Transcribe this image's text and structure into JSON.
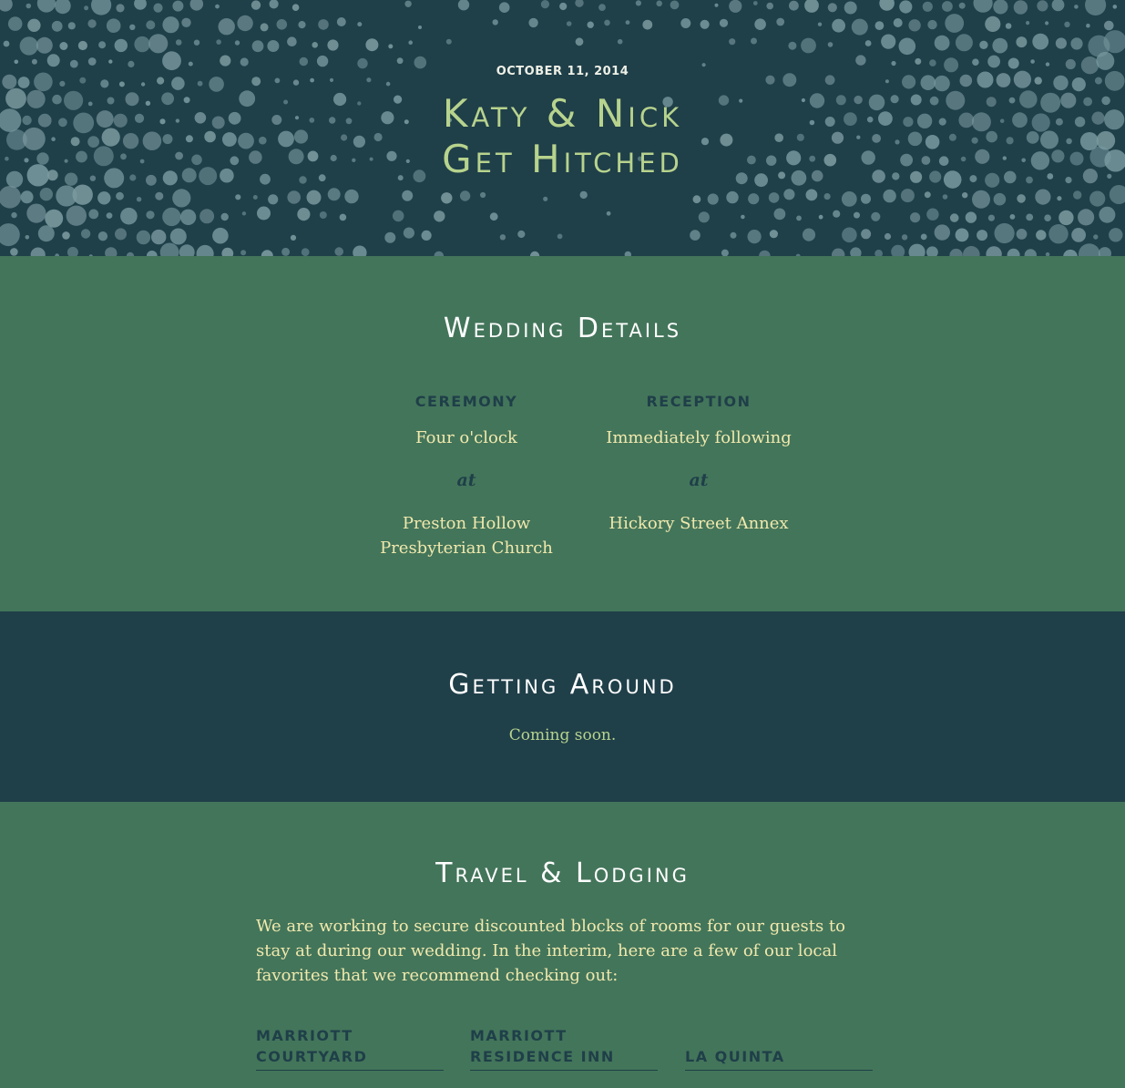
{
  "hero": {
    "date": "OCTOBER 11, 2014",
    "title_line1": "Katy & Nick",
    "title_line2": "Get Hitched"
  },
  "wedding_details": {
    "title": "Wedding Details",
    "ceremony": {
      "heading": "CEREMONY",
      "time": "Four o'clock",
      "at": "at",
      "venue_line1": "Preston Hollow",
      "venue_line2": "Presbyterian Church"
    },
    "reception": {
      "heading": "RECEPTION",
      "time": "Immediately following",
      "at": "at",
      "venue_line1": "Hickory Street Annex"
    }
  },
  "getting_around": {
    "title": "Getting Around",
    "text": "Coming soon."
  },
  "travel": {
    "title": "Travel & Lodging",
    "intro": "We are working to secure discounted blocks of rooms for our guests to stay at during our wedding. In the interim, here are a few of our local favorites that we recommend checking out:",
    "hotels": [
      {
        "line1": "Marriott",
        "line2": "Courtyard"
      },
      {
        "line1": "Marriott",
        "line2": "Residence Inn"
      },
      {
        "line1": "",
        "line2": "La Quinta"
      }
    ]
  },
  "colors": {
    "dark_teal": "#1f3f49",
    "green": "#43755a",
    "lime": "#b7d38d",
    "cream": "#f1e9ad",
    "dot": "#7a9aa0"
  }
}
